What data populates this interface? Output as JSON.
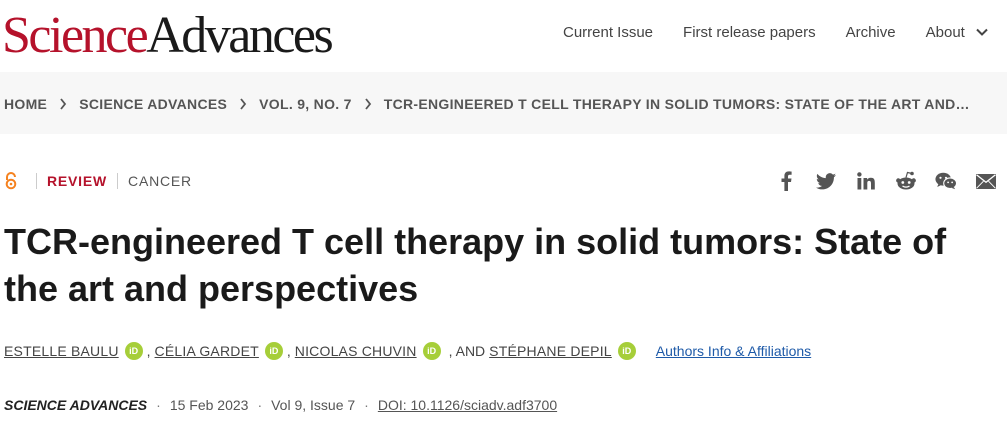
{
  "header": {
    "logo_part1": "Science",
    "logo_part2": "Advances",
    "nav": [
      "Current Issue",
      "First release papers",
      "Archive",
      "About"
    ]
  },
  "breadcrumb": [
    "HOME",
    "SCIENCE ADVANCES",
    "VOL. 9, NO. 7",
    "TCR-ENGINEERED T CELL THERAPY IN SOLID TUMORS: STATE OF THE ART AND…"
  ],
  "article": {
    "type": "REVIEW",
    "subject": "CANCER",
    "title": "TCR-engineered T cell therapy in solid tumors: State of the art and perspectives",
    "authors": [
      "ESTELLE BAULU",
      "CÉLIA GARDET",
      "NICOLAS CHUVIN",
      "STÉPHANE DEPIL"
    ],
    "author_separators": [
      ",",
      ",",
      ", AND"
    ],
    "orcid_label": "iD",
    "affiliations_link": "Authors Info & Affiliations",
    "journal": "SCIENCE ADVANCES",
    "date": "15 Feb 2023",
    "issue": "Vol 9, Issue 7",
    "doi": "DOI: 10.1126/sciadv.adf3700",
    "dot": "·"
  },
  "icons": [
    "open-access-icon",
    "facebook-icon",
    "twitter-icon",
    "linkedin-icon",
    "reddit-icon",
    "wechat-icon",
    "email-icon"
  ],
  "colors": {
    "brand_red": "#b5122b",
    "link_blue": "#1e5aa8",
    "orcid_green": "#a6ce39"
  }
}
